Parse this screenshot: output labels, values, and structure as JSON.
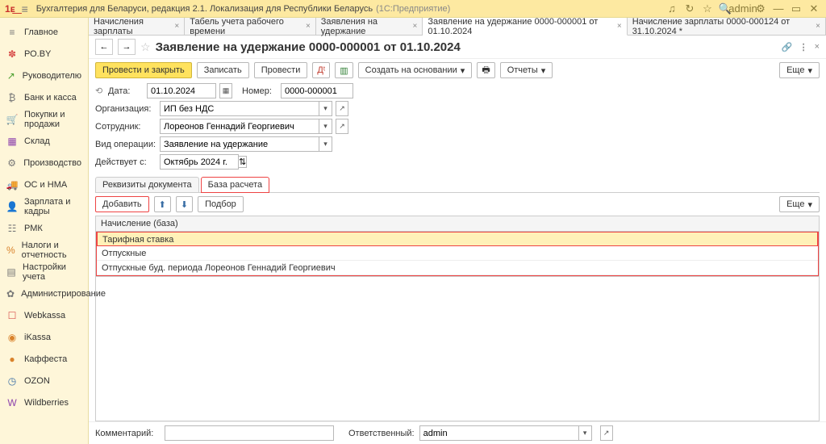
{
  "titlebar": {
    "title": "Бухгалтерия для Беларуси, редакция 2.1. Локализация для Республики Беларусь",
    "subtitle": "(1С:Предприятие)",
    "user": "admin"
  },
  "sidebar": {
    "items": [
      {
        "label": "Главное",
        "icon": "≡",
        "cls": "ci-gray"
      },
      {
        "label": "РО.BY",
        "icon": "✽",
        "cls": "ci-red"
      },
      {
        "label": "Руководителю",
        "icon": "↗",
        "cls": "ci-green"
      },
      {
        "label": "Банк и касса",
        "icon": "₿",
        "cls": "ci-gray"
      },
      {
        "label": "Покупки и продажи",
        "icon": "🛒",
        "cls": "ci-orange"
      },
      {
        "label": "Склад",
        "icon": "▦",
        "cls": "ci-purple"
      },
      {
        "label": "Производство",
        "icon": "⚙",
        "cls": "ci-gray"
      },
      {
        "label": "ОС и НМА",
        "icon": "🚚",
        "cls": "ci-gray"
      },
      {
        "label": "Зарплата и кадры",
        "icon": "👤",
        "cls": "ci-blue"
      },
      {
        "label": "РМК",
        "icon": "☷",
        "cls": "ci-gray"
      },
      {
        "label": "Налоги и отчетность",
        "icon": "%",
        "cls": "ci-orange"
      },
      {
        "label": "Настройки учета",
        "icon": "▤",
        "cls": "ci-gray"
      },
      {
        "label": "Администрирование",
        "icon": "✿",
        "cls": "ci-gray"
      },
      {
        "label": "Webkassa",
        "icon": "☐",
        "cls": "ci-red"
      },
      {
        "label": "iKassa",
        "icon": "◉",
        "cls": "ci-orange"
      },
      {
        "label": "Каффеста",
        "icon": "●",
        "cls": "ci-orange"
      },
      {
        "label": "OZON",
        "icon": "◷",
        "cls": "ci-blue"
      },
      {
        "label": "Wildberries",
        "icon": "W",
        "cls": "ci-purple"
      }
    ]
  },
  "tabs": [
    {
      "label": "Начисления зарплаты"
    },
    {
      "label": "Табель учета рабочего времени"
    },
    {
      "label": "Заявления на удержание"
    },
    {
      "label": "Заявление на удержание 0000-000001 от 01.10.2024",
      "active": true
    },
    {
      "label": "Начисление зарплаты 0000-000124 от 31.10.2024 *"
    }
  ],
  "page": {
    "title": "Заявление на удержание 0000-000001 от 01.10.2024"
  },
  "commands": {
    "post_close": "Провести и закрыть",
    "save": "Записать",
    "post": "Провести",
    "create_based": "Создать на основании",
    "reports": "Отчеты",
    "more": "Еще"
  },
  "fields": {
    "date_label": "Дата:",
    "date_value": "01.10.2024",
    "number_label": "Номер:",
    "number_value": "0000-000001",
    "org_label": "Организация:",
    "org_value": "ИП без НДС",
    "emp_label": "Сотрудник:",
    "emp_value": "Лореонов Геннадий Георгиевич",
    "optype_label": "Вид операции:",
    "optype_value": "Заявление на удержание",
    "effective_label": "Действует с:",
    "effective_value": "Октябрь 2024 г."
  },
  "subtabs": [
    "Реквизиты документа",
    "База расчета"
  ],
  "toolbar": {
    "add": "Добавить",
    "pick": "Подбор",
    "more": "Еще"
  },
  "table": {
    "header": "Начисление (база)",
    "rows": [
      "Тарифная ставка",
      "Отпускные",
      "Отпускные буд. периода Лореонов Геннадий Георгиевич"
    ]
  },
  "footer": {
    "comment_label": "Комментарий:",
    "comment_value": "",
    "responsible_label": "Ответственный:",
    "responsible_value": "admin"
  }
}
